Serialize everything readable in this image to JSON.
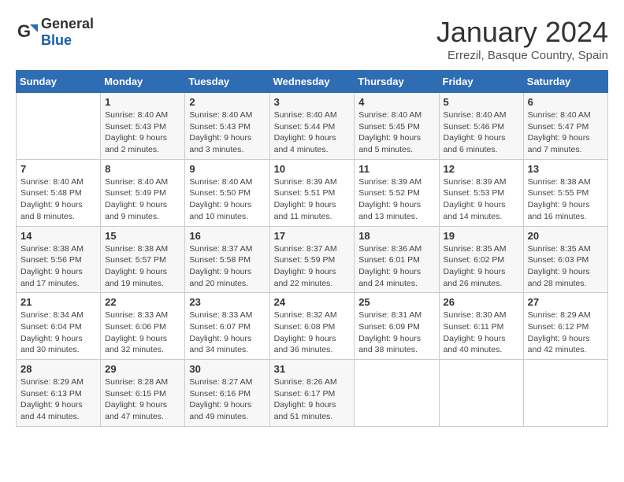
{
  "logo": {
    "general": "General",
    "blue": "Blue"
  },
  "header": {
    "title": "January 2024",
    "subtitle": "Errezil, Basque Country, Spain"
  },
  "weekdays": [
    "Sunday",
    "Monday",
    "Tuesday",
    "Wednesday",
    "Thursday",
    "Friday",
    "Saturday"
  ],
  "weeks": [
    [
      {
        "day": "",
        "info": ""
      },
      {
        "day": "1",
        "info": "Sunrise: 8:40 AM\nSunset: 5:43 PM\nDaylight: 9 hours and 2 minutes."
      },
      {
        "day": "2",
        "info": "Sunrise: 8:40 AM\nSunset: 5:43 PM\nDaylight: 9 hours and 3 minutes."
      },
      {
        "day": "3",
        "info": "Sunrise: 8:40 AM\nSunset: 5:44 PM\nDaylight: 9 hours and 4 minutes."
      },
      {
        "day": "4",
        "info": "Sunrise: 8:40 AM\nSunset: 5:45 PM\nDaylight: 9 hours and 5 minutes."
      },
      {
        "day": "5",
        "info": "Sunrise: 8:40 AM\nSunset: 5:46 PM\nDaylight: 9 hours and 6 minutes."
      },
      {
        "day": "6",
        "info": "Sunrise: 8:40 AM\nSunset: 5:47 PM\nDaylight: 9 hours and 7 minutes."
      }
    ],
    [
      {
        "day": "7",
        "info": "Sunrise: 8:40 AM\nSunset: 5:48 PM\nDaylight: 9 hours and 8 minutes."
      },
      {
        "day": "8",
        "info": "Sunrise: 8:40 AM\nSunset: 5:49 PM\nDaylight: 9 hours and 9 minutes."
      },
      {
        "day": "9",
        "info": "Sunrise: 8:40 AM\nSunset: 5:50 PM\nDaylight: 9 hours and 10 minutes."
      },
      {
        "day": "10",
        "info": "Sunrise: 8:39 AM\nSunset: 5:51 PM\nDaylight: 9 hours and 11 minutes."
      },
      {
        "day": "11",
        "info": "Sunrise: 8:39 AM\nSunset: 5:52 PM\nDaylight: 9 hours and 13 minutes."
      },
      {
        "day": "12",
        "info": "Sunrise: 8:39 AM\nSunset: 5:53 PM\nDaylight: 9 hours and 14 minutes."
      },
      {
        "day": "13",
        "info": "Sunrise: 8:38 AM\nSunset: 5:55 PM\nDaylight: 9 hours and 16 minutes."
      }
    ],
    [
      {
        "day": "14",
        "info": "Sunrise: 8:38 AM\nSunset: 5:56 PM\nDaylight: 9 hours and 17 minutes."
      },
      {
        "day": "15",
        "info": "Sunrise: 8:38 AM\nSunset: 5:57 PM\nDaylight: 9 hours and 19 minutes."
      },
      {
        "day": "16",
        "info": "Sunrise: 8:37 AM\nSunset: 5:58 PM\nDaylight: 9 hours and 20 minutes."
      },
      {
        "day": "17",
        "info": "Sunrise: 8:37 AM\nSunset: 5:59 PM\nDaylight: 9 hours and 22 minutes."
      },
      {
        "day": "18",
        "info": "Sunrise: 8:36 AM\nSunset: 6:01 PM\nDaylight: 9 hours and 24 minutes."
      },
      {
        "day": "19",
        "info": "Sunrise: 8:35 AM\nSunset: 6:02 PM\nDaylight: 9 hours and 26 minutes."
      },
      {
        "day": "20",
        "info": "Sunrise: 8:35 AM\nSunset: 6:03 PM\nDaylight: 9 hours and 28 minutes."
      }
    ],
    [
      {
        "day": "21",
        "info": "Sunrise: 8:34 AM\nSunset: 6:04 PM\nDaylight: 9 hours and 30 minutes."
      },
      {
        "day": "22",
        "info": "Sunrise: 8:33 AM\nSunset: 6:06 PM\nDaylight: 9 hours and 32 minutes."
      },
      {
        "day": "23",
        "info": "Sunrise: 8:33 AM\nSunset: 6:07 PM\nDaylight: 9 hours and 34 minutes."
      },
      {
        "day": "24",
        "info": "Sunrise: 8:32 AM\nSunset: 6:08 PM\nDaylight: 9 hours and 36 minutes."
      },
      {
        "day": "25",
        "info": "Sunrise: 8:31 AM\nSunset: 6:09 PM\nDaylight: 9 hours and 38 minutes."
      },
      {
        "day": "26",
        "info": "Sunrise: 8:30 AM\nSunset: 6:11 PM\nDaylight: 9 hours and 40 minutes."
      },
      {
        "day": "27",
        "info": "Sunrise: 8:29 AM\nSunset: 6:12 PM\nDaylight: 9 hours and 42 minutes."
      }
    ],
    [
      {
        "day": "28",
        "info": "Sunrise: 8:29 AM\nSunset: 6:13 PM\nDaylight: 9 hours and 44 minutes."
      },
      {
        "day": "29",
        "info": "Sunrise: 8:28 AM\nSunset: 6:15 PM\nDaylight: 9 hours and 47 minutes."
      },
      {
        "day": "30",
        "info": "Sunrise: 8:27 AM\nSunset: 6:16 PM\nDaylight: 9 hours and 49 minutes."
      },
      {
        "day": "31",
        "info": "Sunrise: 8:26 AM\nSunset: 6:17 PM\nDaylight: 9 hours and 51 minutes."
      },
      {
        "day": "",
        "info": ""
      },
      {
        "day": "",
        "info": ""
      },
      {
        "day": "",
        "info": ""
      }
    ]
  ]
}
